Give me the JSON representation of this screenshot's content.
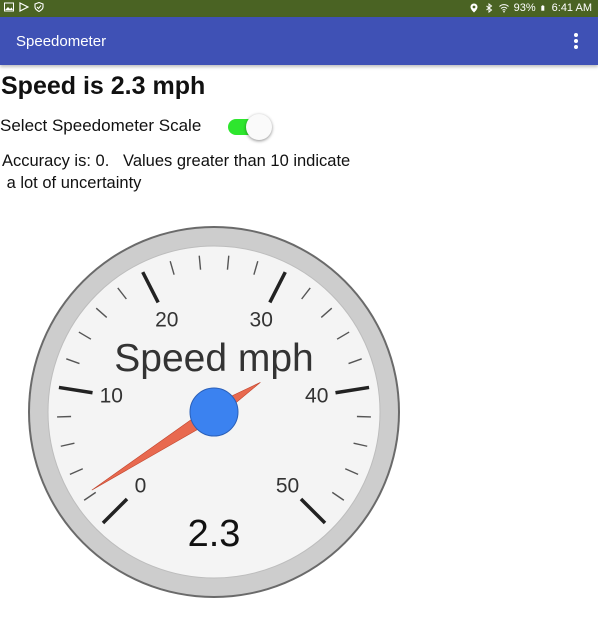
{
  "status_bar": {
    "battery": "93%",
    "time": "6:41 AM",
    "icons": [
      "image-icon",
      "play-store-icon",
      "shield-icon",
      "location-icon",
      "bluetooth-icon",
      "wifi-icon",
      "battery-icon"
    ]
  },
  "app_bar": {
    "title": "Speedometer",
    "menu_icon": "more-vert-icon",
    "color": "#3f51b5"
  },
  "speed_text": "Speed is 2.3 mph",
  "scale_toggle": {
    "label": "Select Speedometer Scale",
    "checked": true,
    "color": "#2ee62e"
  },
  "accuracy": {
    "line1": "Accuracy is: 0.   Values greater than 10 indicate",
    "line2": " a lot of uncertainty"
  },
  "gauge": {
    "title": "Speed mph",
    "value": 2.3,
    "value_text": "2.3",
    "min": 0,
    "max": 50,
    "major_step": 10,
    "minor_per_major": 5,
    "labels": [
      "0",
      "10",
      "20",
      "30",
      "40",
      "50"
    ],
    "needle_color": "#e8694f",
    "hub_color": "#3b82f0"
  }
}
